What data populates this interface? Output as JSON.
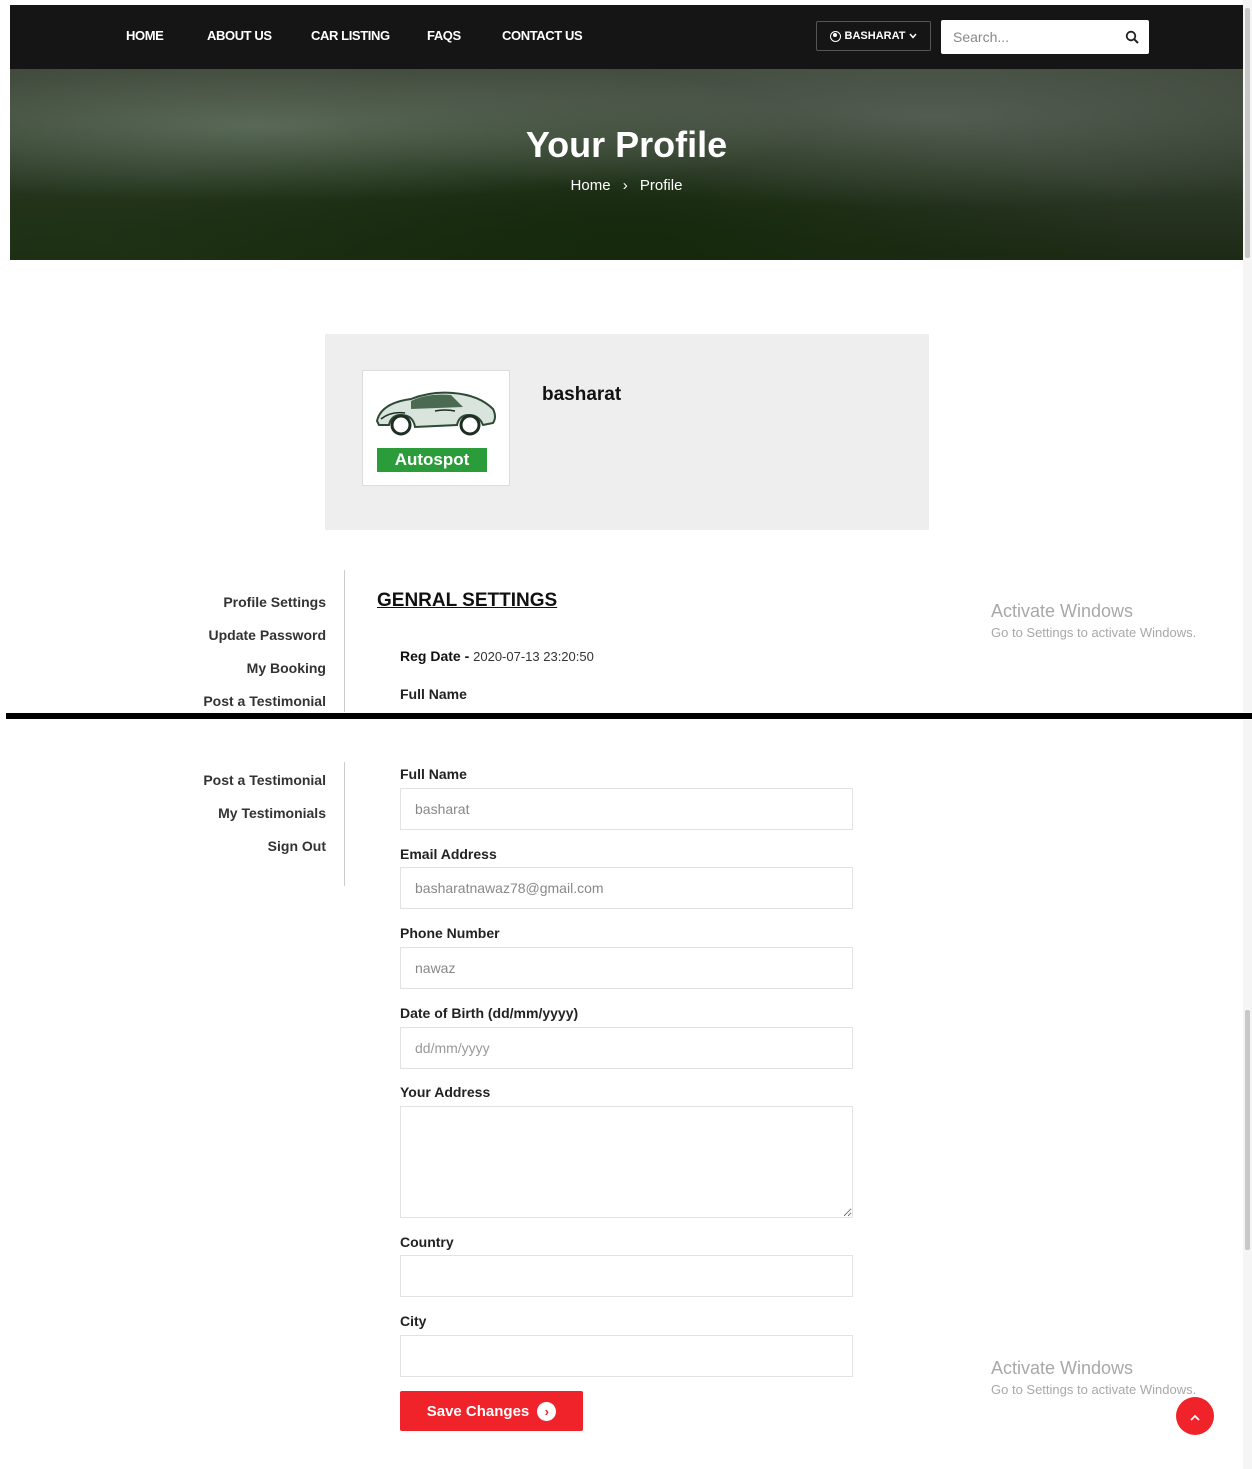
{
  "nav": {
    "links": [
      "HOME",
      "ABOUT US",
      "CAR LISTING",
      "FAQS",
      "CONTACT US"
    ],
    "user_label": "BASHARAT",
    "search_placeholder": "Search..."
  },
  "hero": {
    "title": "Your Profile",
    "breadcrumb": [
      "Home",
      "Profile"
    ]
  },
  "profile": {
    "logo_text": "Autospot",
    "name": "basharat"
  },
  "sidebar": {
    "items": [
      "Profile Settings",
      "Update Password",
      "My Booking",
      "Post a Testimonial",
      "My Testimonials",
      "Sign Out"
    ]
  },
  "settings": {
    "title": "GENRAL SETTINGS",
    "reg_date_label": "Reg Date - ",
    "reg_date_value": "2020-07-13 23:20:50",
    "full_name_label": "Full Name",
    "full_name_value": "basharat",
    "email_label": "Email Address",
    "email_value": "basharatnawaz78@gmail.com",
    "phone_label": "Phone Number",
    "phone_value": "nawaz",
    "dob_label": "Date of Birth (dd/mm/yyyy)",
    "dob_placeholder": "dd/mm/yyyy",
    "address_label": "Your Address",
    "country_label": "Country",
    "city_label": "City",
    "save_label": "Save Changes"
  },
  "watermark": {
    "line1": "Activate Windows",
    "line2": "Go to Settings to activate Windows."
  },
  "colors": {
    "accent": "#f0222a",
    "nav_bg": "#151515",
    "logo_green": "#2a9d3a"
  }
}
